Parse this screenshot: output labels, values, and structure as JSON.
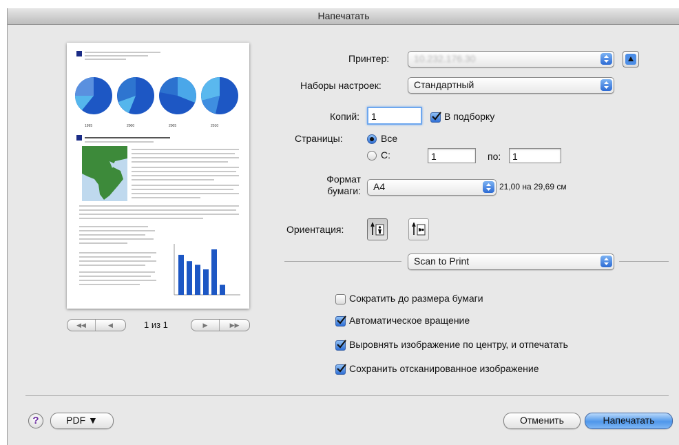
{
  "window": {
    "title": "Напечатать"
  },
  "printer": {
    "label": "Принтер:",
    "value": "10.232.176.30"
  },
  "presets": {
    "label": "Наборы настроек:",
    "value": "Стандартный"
  },
  "copies": {
    "label": "Копий:",
    "value": "1",
    "collate_label": "В подборку",
    "collate_checked": true
  },
  "pages": {
    "label": "Страницы:",
    "all_label": "Все",
    "range_label": "С:",
    "from_value": "1",
    "to_label": "по:",
    "to_value": "1",
    "selected": "all"
  },
  "paper": {
    "label_line1": "Формат",
    "label_line2": "бумаги:",
    "value": "A4",
    "size_text": "21,00 на 29,69 см"
  },
  "orientation": {
    "label": "Ориентация:",
    "selected": "portrait"
  },
  "section": {
    "value": "Scan to Print"
  },
  "options": [
    {
      "label": "Сократить до размера бумаги",
      "checked": false
    },
    {
      "label": "Автоматическое вращение",
      "checked": true
    },
    {
      "label": "Выровнять изображение по центру, и отпечатать",
      "checked": true
    },
    {
      "label": "Сохранить отсканированное изображение",
      "checked": true
    }
  ],
  "preview": {
    "page_indicator": "1 из 1",
    "pie_labels": [
      "1995",
      "2000",
      "2005",
      "2010"
    ],
    "bar_values": [
      88,
      74,
      66,
      56,
      100,
      22
    ]
  },
  "footer": {
    "help_icon": "?",
    "pdf_label": "PDF ▼",
    "cancel_label": "Отменить",
    "print_label": "Напечатать"
  },
  "colors": {
    "accent": "#2f6fd5",
    "chart_blue": "#1d57c4",
    "map_green": "#3d8a3a"
  }
}
